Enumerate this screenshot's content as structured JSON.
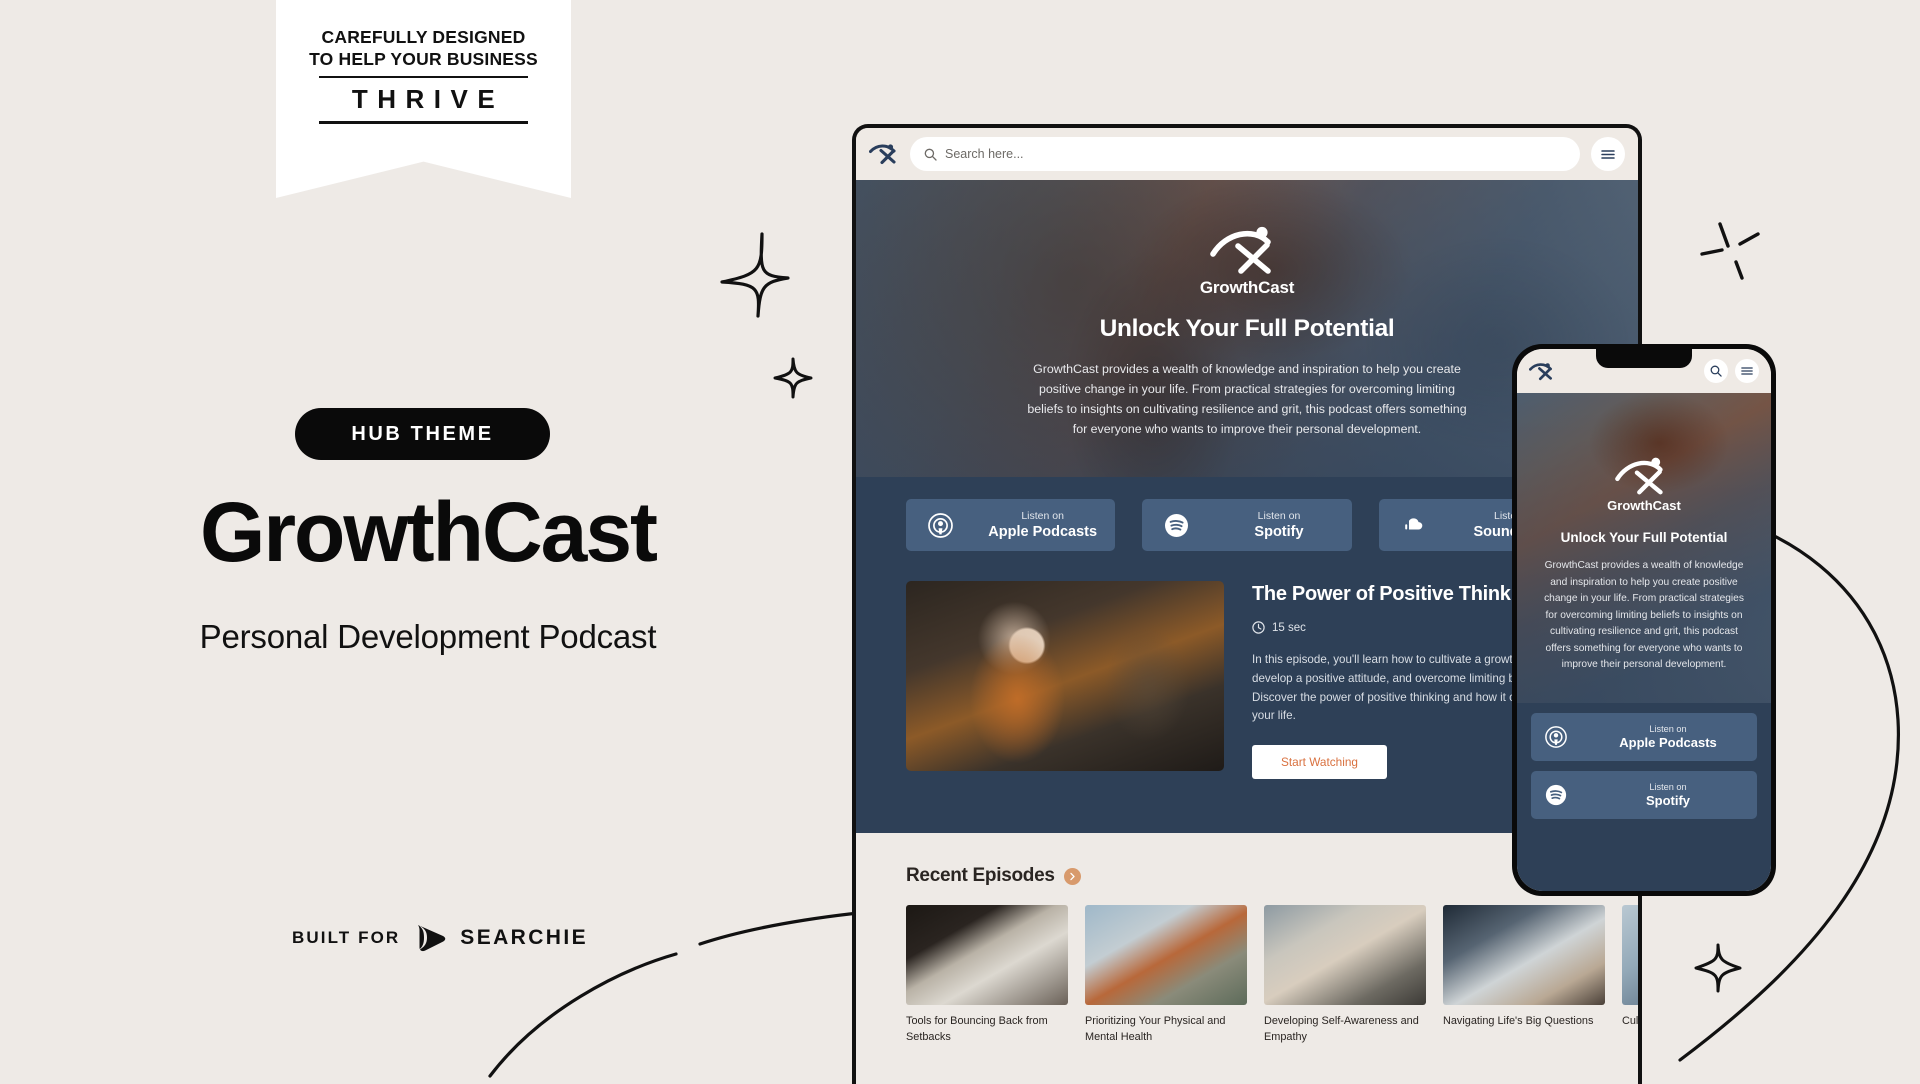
{
  "ribbon": {
    "line1": "CAREFULLY DESIGNED",
    "line2": "TO HELP YOUR BUSINESS",
    "word": "THRIVE"
  },
  "left_panel": {
    "badge": "HUB THEME",
    "title": "GrowthCast",
    "subtitle": "Personal Development Podcast",
    "built_for_label": "BUILT FOR",
    "built_for_brand": "SEARCHIE"
  },
  "colors": {
    "page_background": "#eeeae6",
    "hero_navy": "#2e4057",
    "platform_button": "#47607f",
    "accent_orange": "#d9713f",
    "chevron_orange": "#d89a6c",
    "badge_black": "#0a0a0a"
  },
  "browser": {
    "search_placeholder": "Search here...",
    "menu_icon": "hamburger-icon",
    "search_icon": "search-icon",
    "logo_name": "growthcast-logo"
  },
  "hero": {
    "brand": "GrowthCast",
    "heading": "Unlock Your Full Potential",
    "paragraph": "GrowthCast provides a wealth of knowledge and inspiration to help you create positive change in your life. From practical strategies for overcoming limiting beliefs to insights on cultivating resilience and grit, this podcast offers something for everyone who wants to improve their personal development."
  },
  "platforms": [
    {
      "prefix": "Listen on",
      "name": "Apple Podcasts",
      "icon": "apple-podcasts-icon"
    },
    {
      "prefix": "Listen on",
      "name": "Spotify",
      "icon": "spotify-icon"
    },
    {
      "prefix": "Listen on",
      "name": "Soundcloud",
      "icon": "soundcloud-icon"
    }
  ],
  "featured": {
    "title": "The Power of Positive Thinking",
    "duration": "15 sec",
    "duration_icon": "clock-icon",
    "description": "In this episode, you'll learn how to cultivate a growth mindset, develop a positive attitude, and overcome limiting beliefs. Discover the power of positive thinking and how it can transform your life.",
    "cta": "Start Watching"
  },
  "recent": {
    "heading": "Recent Episodes",
    "arrow_icon": "chevron-right-icon",
    "episodes": [
      {
        "title": "Tools for Bouncing Back from Setbacks"
      },
      {
        "title": "Prioritizing Your Physical and Mental Health"
      },
      {
        "title": "Developing Self-Awareness and Empathy"
      },
      {
        "title": "Navigating Life's Big Questions"
      },
      {
        "title": "Cultivating"
      }
    ]
  },
  "phone": {
    "search_icon": "search-icon",
    "menu_icon": "hamburger-icon",
    "brand": "GrowthCast",
    "heading": "Unlock Your Full Potential",
    "paragraph": "GrowthCast provides a wealth of knowledge and inspiration to help you create positive change in your life. From practical strategies for overcoming limiting beliefs to insights on cultivating resilience and grit, this podcast offers something for everyone who wants to improve their personal development.",
    "platforms": [
      {
        "prefix": "Listen on",
        "name": "Apple Podcasts",
        "icon": "apple-podcasts-icon"
      },
      {
        "prefix": "Listen on",
        "name": "Spotify",
        "icon": "spotify-icon"
      }
    ]
  }
}
